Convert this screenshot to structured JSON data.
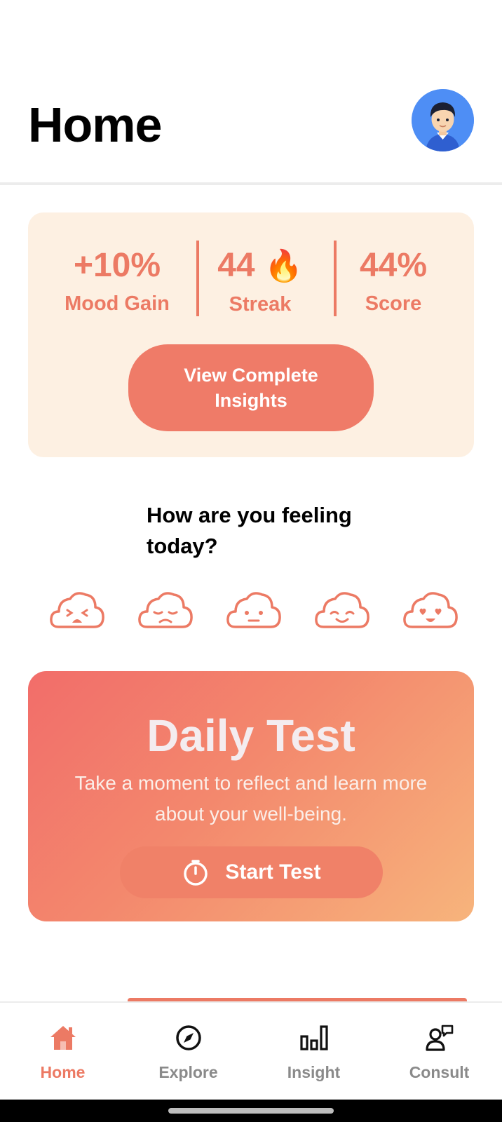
{
  "header": {
    "title": "Home",
    "avatar_icon": "user-avatar-icon"
  },
  "stats": {
    "mood_gain_value": "+10%",
    "mood_gain_label": "Mood Gain",
    "streak_value": "44",
    "streak_emoji": "🔥",
    "streak_label": "Streak",
    "score_value": "44%",
    "score_label": "Score",
    "insights_button": "View Complete Insights"
  },
  "feeling": {
    "question": "How are you feeling today?",
    "moods": [
      "very-sad-cloud-icon",
      "sad-cloud-icon",
      "neutral-cloud-icon",
      "happy-cloud-icon",
      "very-happy-cloud-icon"
    ]
  },
  "daily_test": {
    "title": "Daily Test",
    "description": "Take a moment to reflect and learn more about your well-being.",
    "start_label": "Start Test",
    "start_icon": "timer-icon"
  },
  "tabbar": {
    "tabs": [
      {
        "label": "Home",
        "icon": "home-icon",
        "active": true
      },
      {
        "label": "Explore",
        "icon": "compass-icon",
        "active": false
      },
      {
        "label": "Insight",
        "icon": "bar-chart-icon",
        "active": false
      },
      {
        "label": "Consult",
        "icon": "consult-icon",
        "active": false
      }
    ]
  },
  "colors": {
    "accent": "#ec7a64",
    "card_bg": "#fdf0e2",
    "avatar_bg": "#4e8ef5"
  }
}
